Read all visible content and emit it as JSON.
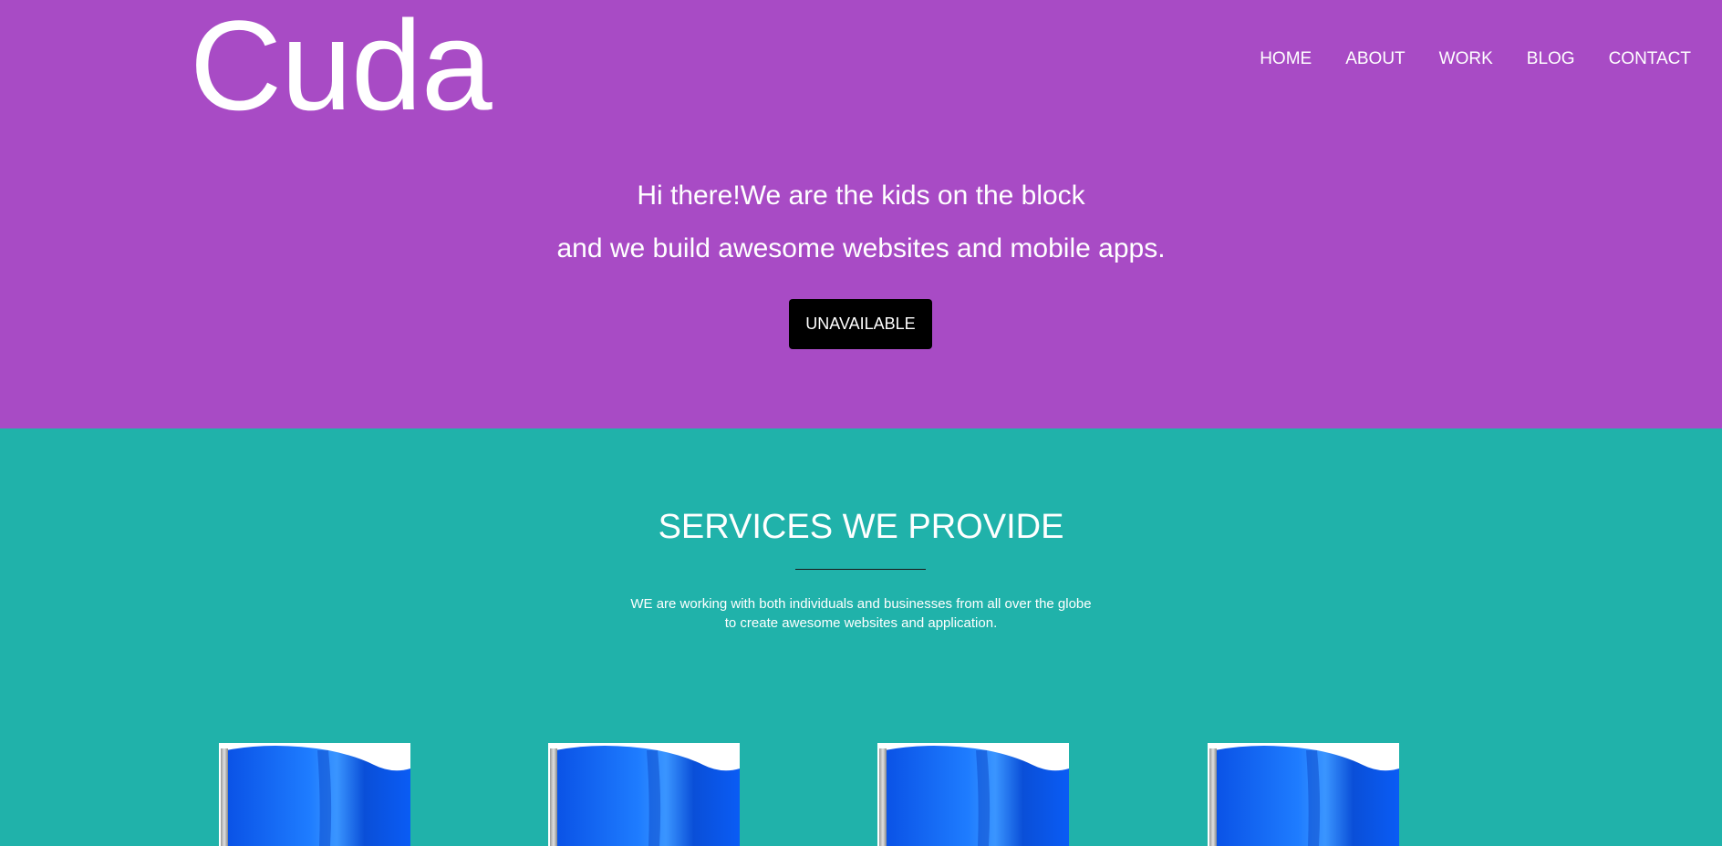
{
  "brand": {
    "logo_text": "Cuda"
  },
  "nav": {
    "items": [
      {
        "label": "HOME"
      },
      {
        "label": "ABOUT"
      },
      {
        "label": "WORK"
      },
      {
        "label": "BLOG"
      },
      {
        "label": "CONTACT"
      }
    ]
  },
  "hero": {
    "line1": "Hi there!We are the kids on the block",
    "line2": "and we build awesome websites and mobile apps.",
    "button_label": "UNAVAILABLE"
  },
  "services": {
    "title": "SERVICES WE PROVIDE",
    "desc_line1": "WE are working with both individuals and businesses from all over the globe",
    "desc_line2": "to create awesome websites and application.",
    "cards": [
      {
        "icon": "blue-flag-icon"
      },
      {
        "icon": "blue-flag-icon"
      },
      {
        "icon": "blue-flag-icon"
      },
      {
        "icon": "blue-flag-icon"
      }
    ]
  },
  "colors": {
    "hero_bg": "#a84bc5",
    "services_bg": "#20b2aa",
    "button_bg": "#000000",
    "flag_blue": "#0a5cf5"
  }
}
